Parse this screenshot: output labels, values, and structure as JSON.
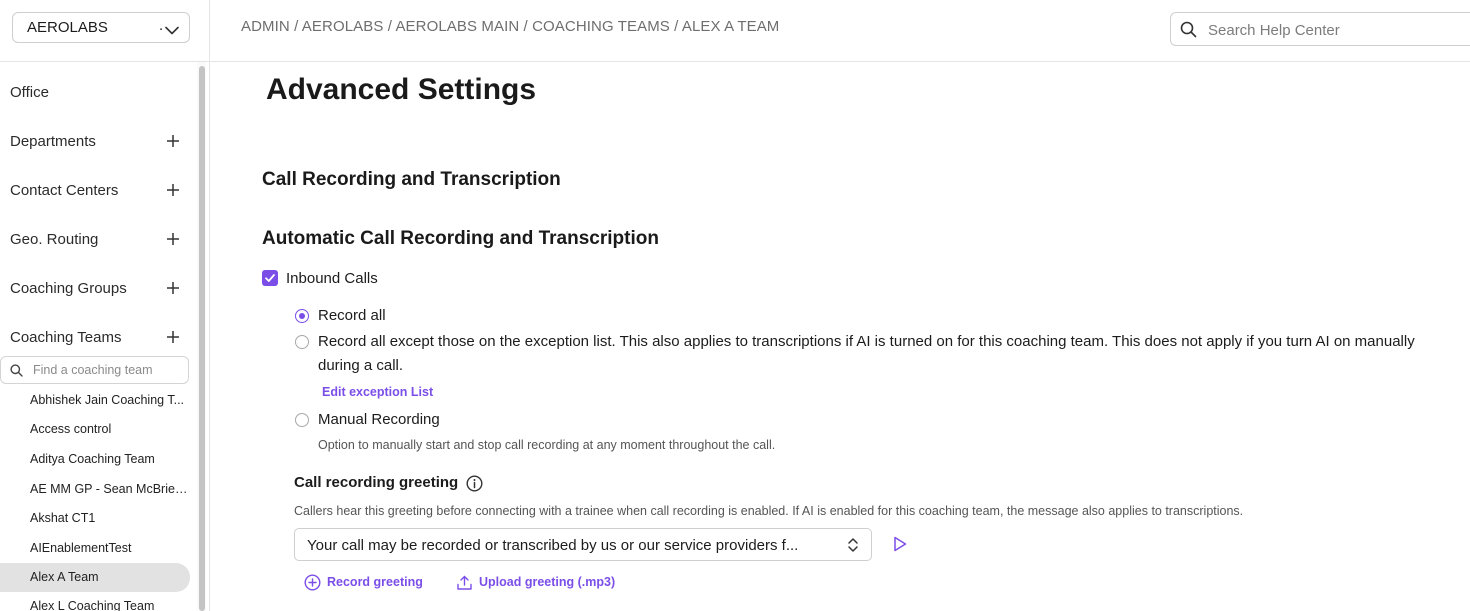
{
  "org_selector": {
    "name": "AEROLABS",
    "suffix": "."
  },
  "sidebar": {
    "nav": [
      {
        "label": "Office",
        "expandable": false
      },
      {
        "label": "Departments",
        "expandable": true
      },
      {
        "label": "Contact Centers",
        "expandable": true
      },
      {
        "label": "Geo. Routing",
        "expandable": true
      },
      {
        "label": "Coaching Groups",
        "expandable": true
      },
      {
        "label": "Coaching Teams",
        "expandable": true
      }
    ],
    "team_search_placeholder": "Find a coaching team",
    "teams": [
      "Abhishek Jain Coaching T...",
      "Access control",
      "Aditya Coaching Team",
      "AE MM GP - Sean McBrien...",
      "Akshat CT1",
      "AIEnablementTest",
      "Alex A Team",
      "Alex L Coaching Team"
    ],
    "selected_team": "Alex A Team"
  },
  "header": {
    "breadcrumb": "ADMIN / AEROLABS / AEROLABS MAIN / COACHING TEAMS / ALEX A TEAM",
    "search_placeholder": "Search Help Center"
  },
  "main": {
    "title": "Advanced Settings",
    "section_title": "Call Recording and Transcription",
    "subsection_title": "Automatic Call Recording and Transcription",
    "inbound_calls": {
      "label": "Inbound Calls",
      "checked": true
    },
    "options": {
      "record_all": {
        "label": "Record all",
        "selected": true
      },
      "record_except": {
        "label": "Record all except those on the exception list. This also applies to transcriptions if AI is turned on for this coaching team. This does not apply if you turn AI on manually during a call.",
        "selected": false,
        "link": "Edit exception List"
      },
      "manual": {
        "label": "Manual Recording",
        "selected": false,
        "helper": "Option to manually start and stop call recording at any moment throughout the call."
      }
    },
    "greeting": {
      "title": "Call recording greeting",
      "description": "Callers hear this greeting before connecting with a trainee when call recording is enabled. If AI is enabled for this coaching team, the message also applies to transcriptions.",
      "selected_value": "Your call may be recorded or transcribed by us or our service providers f...",
      "record_label": "Record greeting",
      "upload_label": "Upload greeting (.mp3)"
    }
  },
  "colors": {
    "accent": "#7b4ee8",
    "selected_bg": "#e2e2e2",
    "border": "#cfcfcf"
  }
}
